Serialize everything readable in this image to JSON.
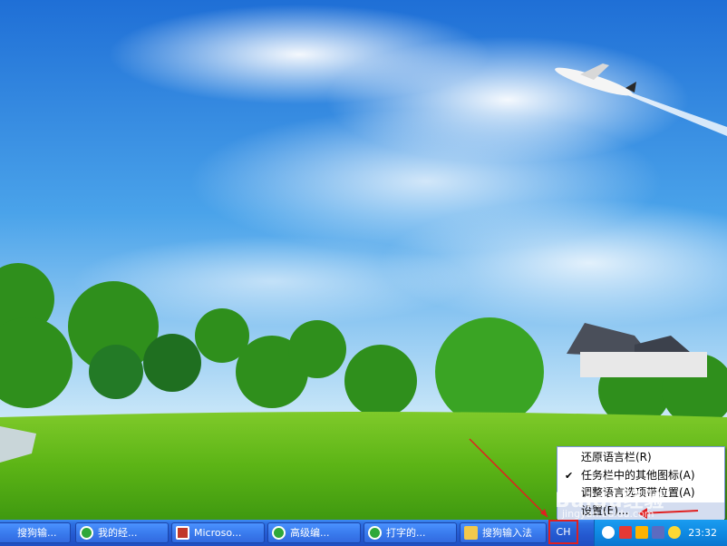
{
  "context_menu": {
    "items": [
      {
        "label": "还原语言栏(R)",
        "checked": false
      },
      {
        "label": "任务栏中的其他图标(A)",
        "checked": true
      },
      {
        "label": "调整语言选项带位置(A)",
        "checked": false
      },
      {
        "label": "设置(E)...",
        "checked": false
      }
    ]
  },
  "taskbar": {
    "buttons": [
      {
        "label": "搜狗输...",
        "icon": "app-icon"
      },
      {
        "label": "我的经...",
        "icon": "ie-icon"
      },
      {
        "label": "Microso...",
        "icon": "ms-icon"
      },
      {
        "label": "高级编...",
        "icon": "ie-icon"
      },
      {
        "label": "打字的...",
        "icon": "ie-icon"
      },
      {
        "label": "搜狗输入法",
        "icon": "folder-icon"
      }
    ],
    "language_indicator": "CH",
    "clock": "23:32"
  },
  "watermark": {
    "brand": "Baidu经验",
    "url": "jingyan.baidu.com"
  },
  "colors": {
    "taskbar": "#245edc",
    "tray": "#0f8ae3",
    "annotation": "#e02020"
  }
}
